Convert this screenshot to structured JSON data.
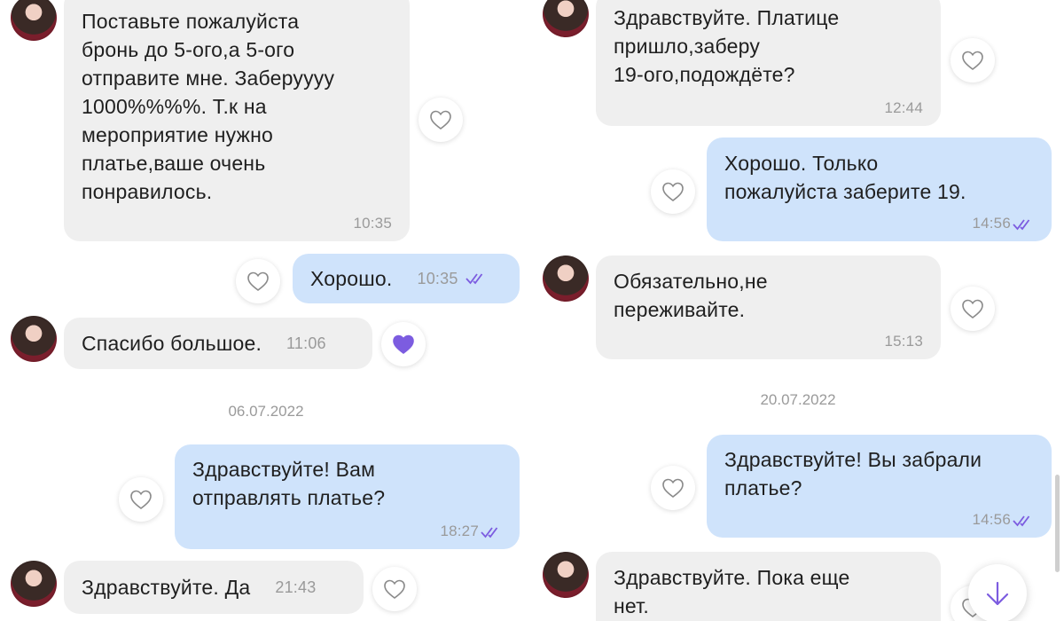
{
  "left_pane": {
    "messages": [
      {
        "text": "Поставьте пожалуйста\nбронь до 5-ого,а 5-ого\nотправите мне. Заберуууу\n1000%%%%. Т.к на\nмероприятие нужно\nплатье,ваше очень\nпонравилось.",
        "time": "10:35"
      },
      {
        "text": "Хорошо.",
        "time": "10:35"
      },
      {
        "text": "Спасибо большое.",
        "time": "11:06"
      },
      {
        "text": "Здравствуйте! Вам\nотправлять платье?",
        "time": "18:27"
      },
      {
        "text": "Здравствуйте. Да",
        "time": "21:43"
      }
    ],
    "date_separator": "06.07.2022"
  },
  "right_pane": {
    "messages": [
      {
        "text": "Здравствуйте. Платице\nпришло,заберу\n19-ого,подождёте?",
        "time": "12:44"
      },
      {
        "text": "Хорошо. Только\nпожалуйста заберите 19.",
        "time": "14:56"
      },
      {
        "text": "Обязательно,не\nпереживайте.",
        "time": "15:13"
      },
      {
        "text": "Здравствуйте! Вы забрали\nплатье?",
        "time": "14:56"
      },
      {
        "text": "Здравствуйте. Пока еще\nнет.",
        "time": ""
      }
    ],
    "date_separator": "20.07.2022"
  },
  "colors": {
    "incoming_bubble": "#efefef",
    "outgoing_bubble": "#cfe3fb",
    "accent": "#7c5ce0"
  },
  "icons": {
    "like": "heart-outline-icon",
    "liked": "heart-filled-icon",
    "read": "double-check-icon",
    "scroll_down": "arrow-down-icon"
  }
}
